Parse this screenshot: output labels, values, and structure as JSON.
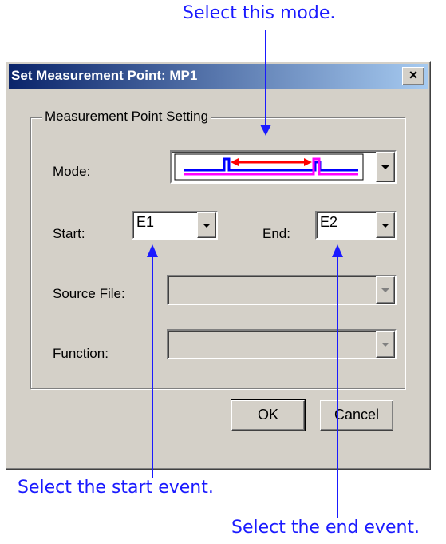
{
  "annotations": {
    "mode": "Select this mode.",
    "start": "Select the start event.",
    "end": "Select the end event."
  },
  "dialog": {
    "title": "Set Measurement Point: MP1",
    "close_label": "×",
    "group_label": "Measurement Point Setting",
    "mode_label": "Mode:",
    "start_label": "Start:",
    "start_value": "E1",
    "end_label": "End:",
    "end_value": "E2",
    "source_file_label": "Source File:",
    "source_file_value": "",
    "function_label": "Function:",
    "function_value": "",
    "ok_label": "OK",
    "cancel_label": "Cancel"
  },
  "colors": {
    "annotation": "#1a1aff",
    "title_start": "#0a246a",
    "title_end": "#a6caf0",
    "dialog_bg": "#d4d0c8",
    "mode_signal_blue": "#0000ff",
    "mode_signal_magenta": "#ff00ff",
    "mode_arrow_red": "#ff0000"
  },
  "icons": {
    "close": "close-icon",
    "dropdown": "chevron-down-icon",
    "mode_preview": "waveform-interval-icon"
  }
}
